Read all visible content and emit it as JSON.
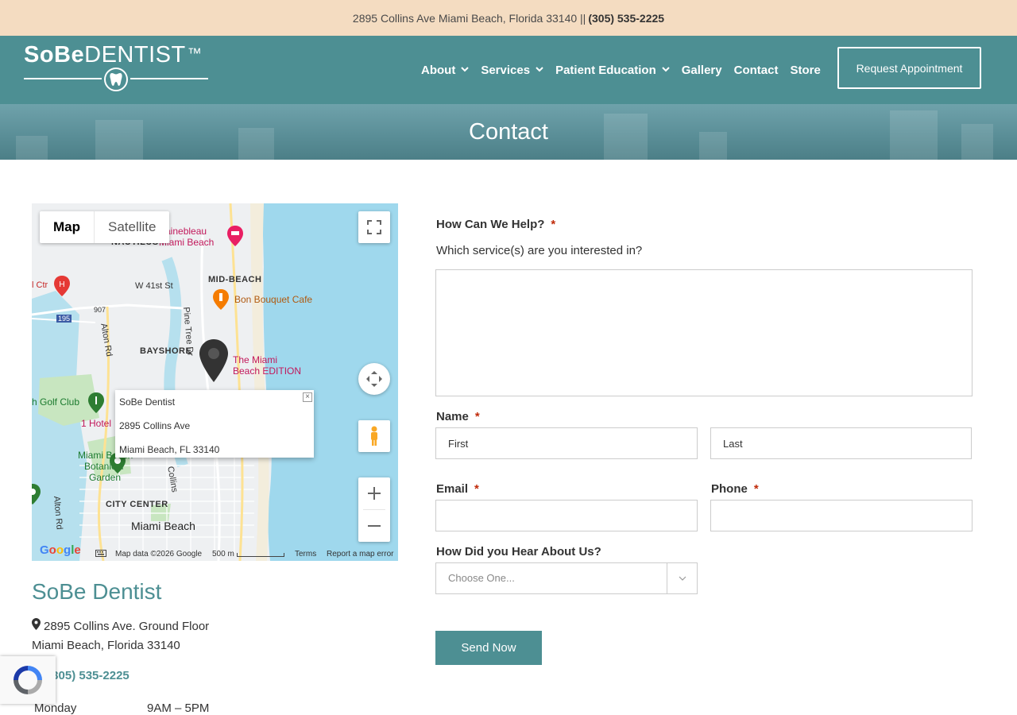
{
  "topbar": {
    "address": "2895 Collins Ave Miami Beach, Florida 33140 ||",
    "phone": "(305) 535-2225"
  },
  "header": {
    "logo_bold": "SoBe",
    "logo_light": "DENTIST",
    "logo_tm": "™",
    "nav": [
      {
        "label": "About",
        "dropdown": true
      },
      {
        "label": "Services",
        "dropdown": true
      },
      {
        "label": "Patient Education",
        "dropdown": true
      },
      {
        "label": "Gallery",
        "dropdown": false
      },
      {
        "label": "Contact",
        "dropdown": false
      },
      {
        "label": "Store",
        "dropdown": false
      }
    ],
    "request_button": "Request Appointment"
  },
  "hero": {
    "title": "Contact"
  },
  "map": {
    "type_active": "Map",
    "type_inactive": "Satellite",
    "info_window": {
      "name": "SoBe Dentist",
      "street": "2895 Collins Ave",
      "city": "Miami Beach, FL 33140"
    },
    "labels": {
      "fontainebleau_1": "ntainebleau",
      "fontainebleau_2": "Miami Beach",
      "nautilus": "NAUTILUS",
      "w41": "W 41st St",
      "ctr": "l Ctr",
      "midbeach": "MID-BEACH",
      "bonbouquet": "Bon Bouquet Cafe",
      "pinetree": "Pine Tree Dr",
      "r907": "907",
      "i195": "195",
      "bayshore": "BAYSHORE",
      "edition_1": "The Miami",
      "edition_2": "Beach EDITION",
      "altonrd": "Alton Rd",
      "golf": "h Golf Club",
      "hotel1": "1 Hotel",
      "botanical_1": "Miami Beach",
      "botanical_2": "Botanical",
      "botanical_3": "Garden",
      "collins": "Collins",
      "citycenter": "CITY CENTER",
      "miamibeach": "Miami Beach",
      "altonrd2": "Alton Rd"
    },
    "footer": {
      "google": "Google",
      "mapdata": "Map data ©2026 Google",
      "scale": "500 m",
      "terms": "Terms",
      "report": "Report a map error"
    }
  },
  "contact": {
    "name": "SoBe Dentist",
    "address_line1": "2895 Collins Ave. Ground Floor",
    "address_line2": "Miami Beach, Florida 33140",
    "phone": "(305) 535-2225",
    "hours": [
      {
        "day": "Monday",
        "time": "9AM – 5PM"
      }
    ]
  },
  "form": {
    "help_label": "How Can We Help?",
    "help_desc": "Which service(s) are you interested in?",
    "name_label": "Name",
    "first_placeholder": "First",
    "last_placeholder": "Last",
    "email_label": "Email",
    "phone_label": "Phone",
    "hear_label": "How Did you Hear About Us?",
    "hear_selected": "Choose One...",
    "required_mark": "*",
    "submit": "Send Now"
  },
  "colors": {
    "accent": "#4d8f93",
    "topbar": "#f4dcc1",
    "required": "#c02b0a"
  }
}
